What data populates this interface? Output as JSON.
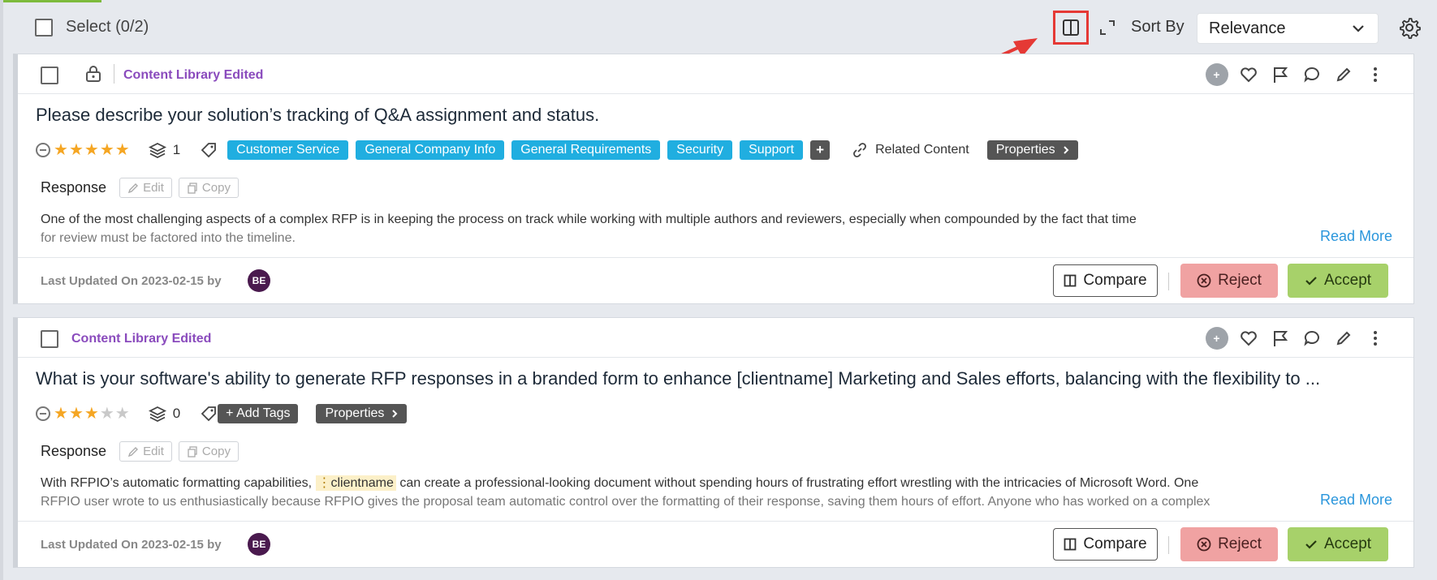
{
  "toolbar": {
    "select_label": "Select (0/2)",
    "sort_by_label": "Sort By",
    "sort_value": "Relevance",
    "icons": [
      "split-view-icon",
      "expand-icon",
      "chevron-down-icon",
      "gear-icon"
    ],
    "highlight_color": "#e53935"
  },
  "cards": [
    {
      "library_tag": "Content Library Edited",
      "question": "Please describe your solution’s tracking of Q&A assignment and status.",
      "rating": 5,
      "linked_count": "1",
      "tags": [
        "Customer Service",
        "General Company Info",
        "General Requirements",
        "Security",
        "Support"
      ],
      "more_tags": "+",
      "related_content": "Related Content",
      "properties": "Properties",
      "response_label": "Response",
      "edit_label": "Edit",
      "copy_label": "Copy",
      "response_line1": "One of the most challenging aspects of a complex RFP is in keeping the process on track while working with multiple authors and reviewers, especially when compounded by the fact that time",
      "response_line2": "for review must be factored into the timeline.",
      "read_more": "Read More",
      "updated": "Last Updated On 2023-02-15 by",
      "avatar": "BE",
      "compare": "Compare",
      "reject": "Reject",
      "accept": "Accept"
    },
    {
      "library_tag": "Content Library Edited",
      "question": "What is your software's ability to generate RFP responses in a branded form to enhance [clientname] Marketing and Sales efforts, balancing with the flexibility to ...",
      "rating": 3,
      "linked_count": "0",
      "add_tags": "+ Add Tags",
      "properties": "Properties",
      "response_label": "Response",
      "edit_label": "Edit",
      "copy_label": "Copy",
      "response_pre": "With RFPIO’s automatic formatting capabilities,",
      "response_token": "clientname",
      "response_post": "can create a professional-looking document without spending hours of frustrating effort wrestling with the intricacies of Microsoft Word. One",
      "response_line2": "RFPIO user wrote to us enthusiastically because RFPIO gives the proposal team automatic control over the formatting of their response, saving them hours of effort. Anyone who has worked on a complex",
      "read_more": "Read More",
      "updated": "Last Updated On 2023-02-15 by",
      "avatar": "BE",
      "compare": "Compare",
      "reject": "Reject",
      "accept": "Accept"
    }
  ],
  "colors": {
    "tag": "#20aee0",
    "library_tag": "#8a4bbd",
    "reject": "#f0a2a2",
    "accept": "#a7d16a",
    "read_more": "#2a96dc"
  }
}
